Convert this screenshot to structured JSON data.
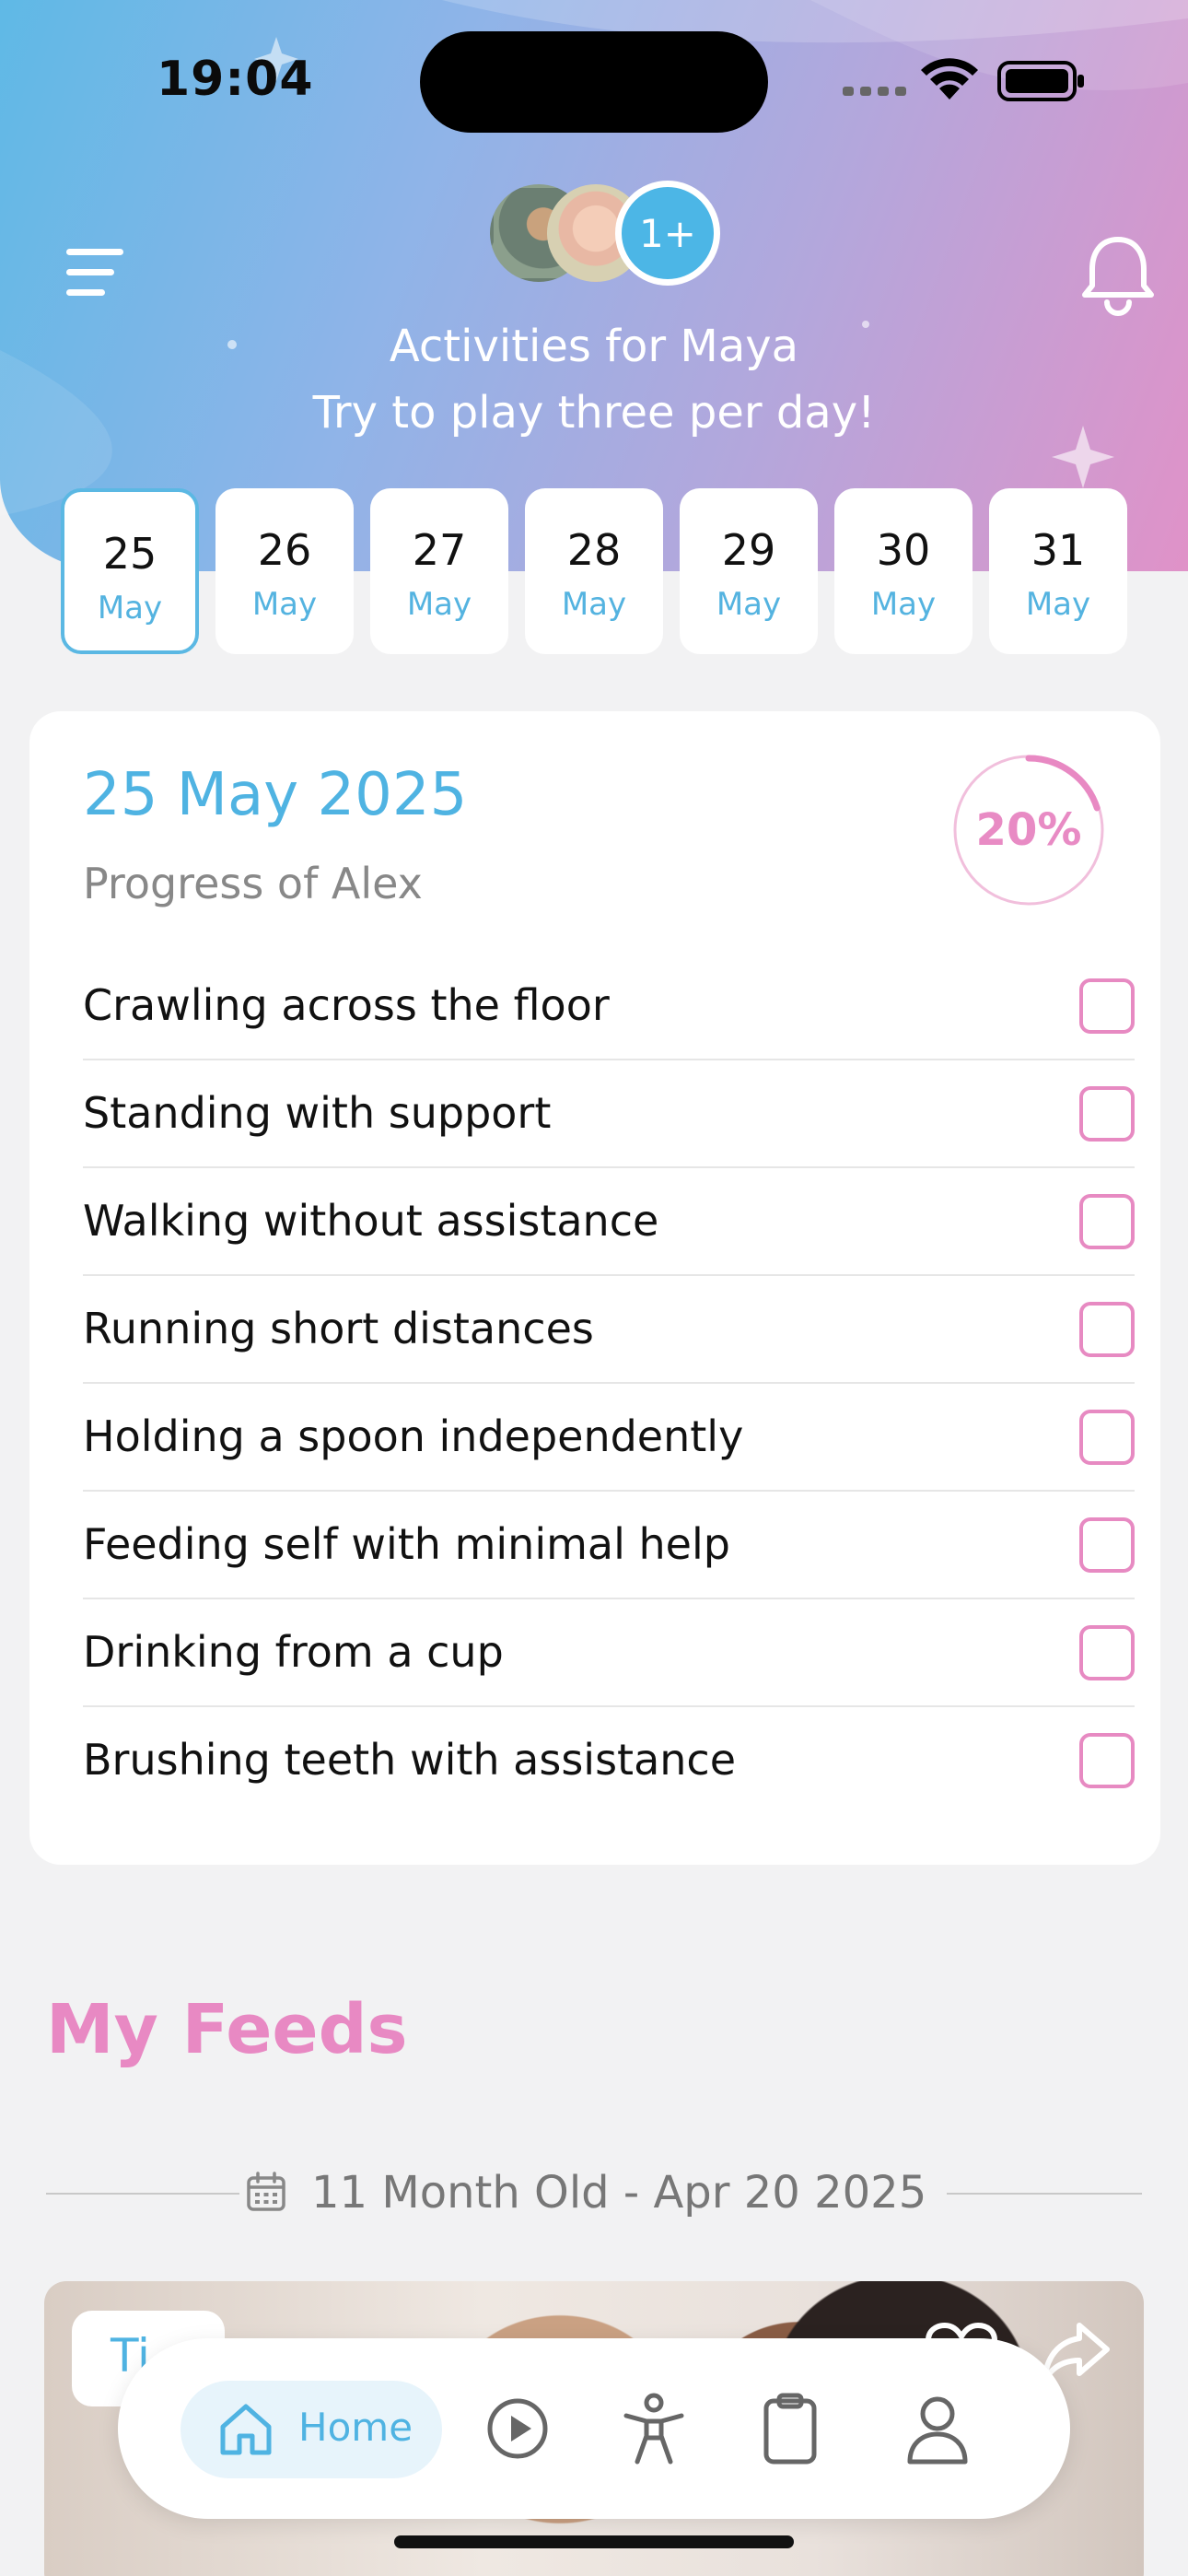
{
  "status_bar": {
    "time": "19:04"
  },
  "header": {
    "title": "Activities for Maya",
    "subtitle": "Try to play three per day!",
    "more_children_label": "1+"
  },
  "dates": [
    {
      "day": "25",
      "month": "May",
      "selected": true
    },
    {
      "day": "26",
      "month": "May"
    },
    {
      "day": "27",
      "month": "May"
    },
    {
      "day": "28",
      "month": "May"
    },
    {
      "day": "29",
      "month": "May"
    },
    {
      "day": "30",
      "month": "May"
    },
    {
      "day": "31",
      "month": "May"
    }
  ],
  "card": {
    "date": "25 May 2025",
    "subtitle": "Progress of Alex",
    "progress_label": "20%",
    "progress_fraction": 0.2,
    "tasks": [
      {
        "label": "Crawling across the floor",
        "checked": false
      },
      {
        "label": "Standing with support",
        "checked": false
      },
      {
        "label": "Walking without assistance",
        "checked": false
      },
      {
        "label": "Running short distances",
        "checked": false
      },
      {
        "label": "Holding a spoon independently",
        "checked": false
      },
      {
        "label": "Feeding self with minimal help",
        "checked": false
      },
      {
        "label": "Drinking from a cup",
        "checked": false
      },
      {
        "label": "Brushing teeth with assistance",
        "checked": false
      }
    ]
  },
  "feeds": {
    "title": "My Feeds",
    "date_label": "11 Month Old - Apr 20 2025",
    "tag_label": "Ti"
  },
  "tabbar": {
    "home_label": "Home",
    "icons": [
      "home-icon",
      "play-icon",
      "activity-icon",
      "clipboard-icon",
      "profile-icon"
    ]
  },
  "colors": {
    "accent_blue": "#4fb3e2",
    "accent_pink": "#e889c3",
    "background": "#f2f2f3"
  }
}
